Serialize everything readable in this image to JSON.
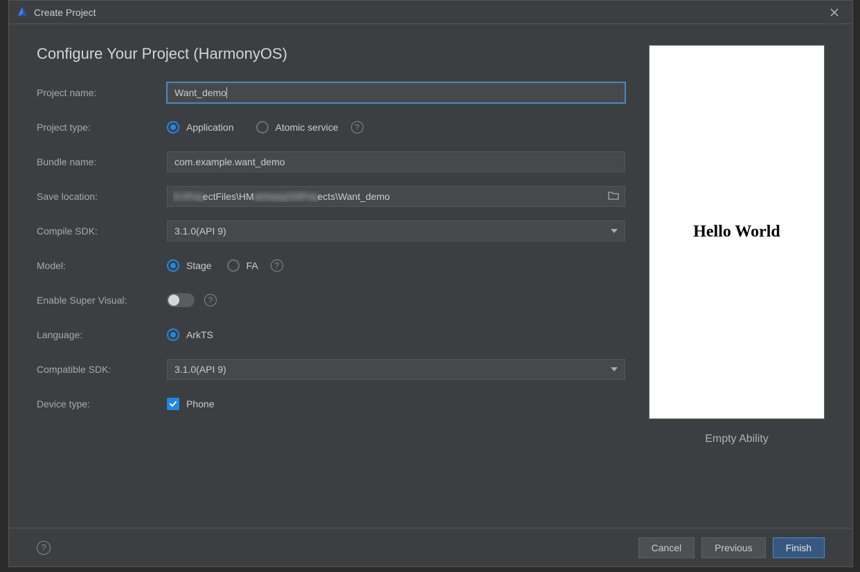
{
  "titlebar": {
    "title": "Create Project"
  },
  "heading": "Configure Your Project (HarmonyOS)",
  "labels": {
    "project_name": "Project name:",
    "project_type": "Project type:",
    "bundle_name": "Bundle name:",
    "save_location": "Save location:",
    "compile_sdk": "Compile SDK:",
    "model": "Model:",
    "enable_super_visual": "Enable Super Visual:",
    "language": "Language:",
    "compatible_sdk": "Compatible SDK:",
    "device_type": "Device type:"
  },
  "fields": {
    "project_name": "Want_demo",
    "project_type": {
      "options": [
        "Application",
        "Atomic service"
      ],
      "selected": "Application"
    },
    "bundle_name": "com.example.want_demo",
    "save_location_visible_prefix": "ectFiles\\HM",
    "save_location_visible_suffix": "ects\\Want_demo",
    "compile_sdk": {
      "options": [
        "3.1.0(API 9)"
      ],
      "selected": "3.1.0(API 9)"
    },
    "model": {
      "options": [
        "Stage",
        "FA"
      ],
      "selected": "Stage"
    },
    "enable_super_visual": false,
    "language": {
      "options": [
        "ArkTS"
      ],
      "selected": "ArkTS"
    },
    "compatible_sdk": {
      "options": [
        "3.1.0(API 9)"
      ],
      "selected": "3.1.0(API 9)"
    },
    "device_type": {
      "options": [
        "Phone"
      ],
      "selected": [
        "Phone"
      ]
    }
  },
  "preview": {
    "text": "Hello World",
    "caption": "Empty Ability"
  },
  "footer": {
    "cancel": "Cancel",
    "previous": "Previous",
    "finish": "Finish"
  }
}
